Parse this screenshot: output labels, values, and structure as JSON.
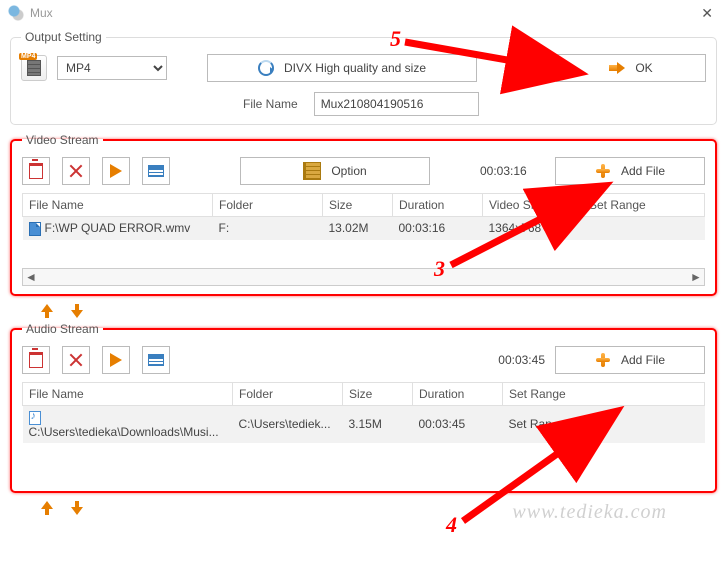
{
  "window": {
    "title": "Mux"
  },
  "output": {
    "legend": "Output Setting",
    "format": "MP4",
    "profile_label": "DIVX High quality and size",
    "filename_label": "File Name",
    "filename_value": "Mux210804190516",
    "ok_label": "OK"
  },
  "video": {
    "legend": "Video Stream",
    "option_label": "Option",
    "total_duration": "00:03:16",
    "addfile_label": "Add File",
    "columns": [
      "File Name",
      "Folder",
      "Size",
      "Duration",
      "Video Size",
      "Set Range"
    ],
    "row": {
      "filename": "F:\\WP QUAD ERROR.wmv",
      "folder": "F:",
      "size": "13.02M",
      "duration": "00:03:16",
      "videosize": "1364x768",
      "setrange": ""
    }
  },
  "audio": {
    "legend": "Audio Stream",
    "total_duration": "00:03:45",
    "addfile_label": "Add File",
    "columns": [
      "File Name",
      "Folder",
      "Size",
      "Duration",
      "Set Range"
    ],
    "row": {
      "filename": "C:\\Users\\tedieka\\Downloads\\Musi...",
      "folder": "C:\\Users\\tediek...",
      "size": "3.15M",
      "duration": "00:03:45",
      "setrange": "Set Ran"
    }
  },
  "annotations": {
    "n3": "3",
    "n4": "4",
    "n5": "5"
  },
  "watermark": "www.tedieka.com"
}
